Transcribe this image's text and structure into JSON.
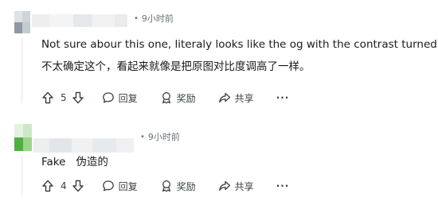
{
  "comments": [
    {
      "time": "9小时前",
      "lines": [
        "Not sure abour this one, literaly looks like the og with the contrast turned up",
        "不太确定这个，看起来就像是把原图对比度调高了一样。"
      ],
      "votes": "5",
      "reply_label": "回复",
      "award_label": "奖励",
      "share_label": "共享",
      "more_label": "···"
    },
    {
      "time": "9小时前",
      "lines": [
        "Fake   伪造的"
      ],
      "votes": "4",
      "reply_label": "回复",
      "award_label": "奖励",
      "share_label": "共享",
      "more_label": "···"
    }
  ],
  "colors": {
    "avatar1": [
      "#c9cfd6",
      "#9aa3ad",
      "#e8ebee",
      "#b8c0c8"
    ],
    "avatar2": [
      "#d8ecd2",
      "#4caf3f",
      "#a8d79c",
      "#e9f5e5"
    ],
    "meta_text": "#6b7478",
    "body_text": "#1a1a1b"
  }
}
